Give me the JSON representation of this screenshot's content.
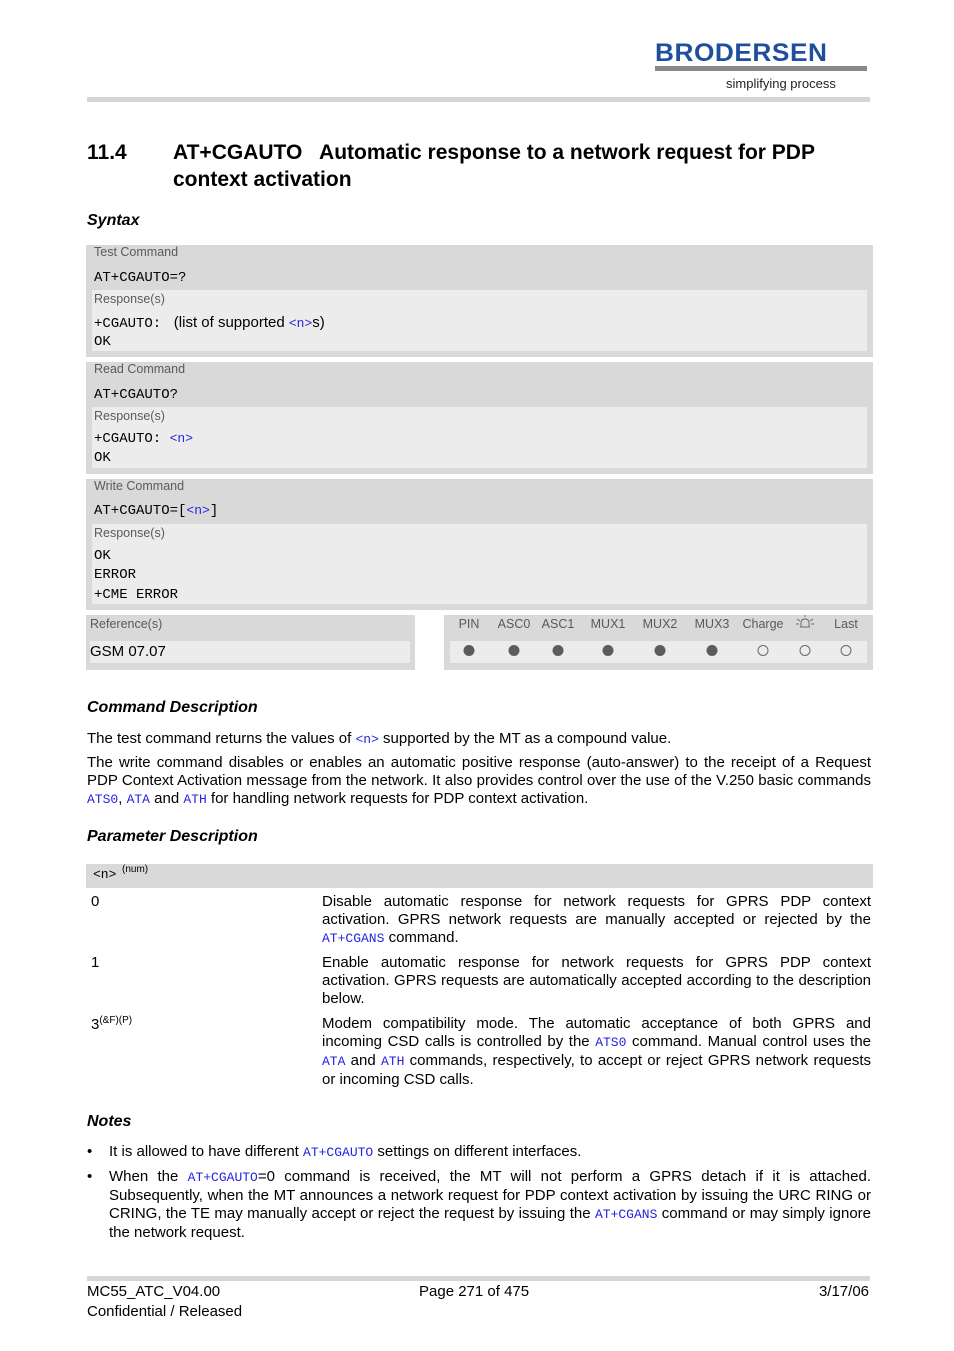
{
  "header": {
    "brand": "BRODERSEN",
    "tagline": "simplifying process",
    "brand_color": "#1e4f9c"
  },
  "section": {
    "number": "11.4",
    "title": "AT+CGAUTO   Automatic response to a network request for PDP context activation"
  },
  "syntax": {
    "heading": "Syntax",
    "test": {
      "label": "Test Command",
      "command": "AT+CGAUTO=?",
      "response_label": "Response(s)",
      "response_prefix": "+CGAUTO: ",
      "response_text_a": " (list of supported ",
      "response_param": "<n>",
      "response_text_b": "s)",
      "response_ok": "OK"
    },
    "read": {
      "label": "Read Command",
      "command": "AT+CGAUTO?",
      "response_label": "Response(s)",
      "response_prefix": "+CGAUTO: ",
      "response_param": "<n>",
      "response_ok": "OK"
    },
    "write": {
      "label": "Write Command",
      "command_prefix": "AT+CGAUTO=[",
      "command_param": "<n>",
      "command_suffix": "]",
      "response_label": "Response(s)",
      "responses": [
        "OK",
        "ERROR",
        "+CME ERROR"
      ]
    },
    "reference": {
      "label": "Reference(s)",
      "value": "GSM 07.07"
    },
    "interfaces": {
      "headers": [
        "PIN",
        "ASC0",
        "ASC1",
        "MUX1",
        "MUX2",
        "MUX3",
        "Charge",
        "alarm-icon",
        "Last"
      ],
      "values": [
        "filled",
        "filled",
        "filled",
        "filled",
        "filled",
        "filled",
        "empty",
        "empty",
        "empty"
      ]
    }
  },
  "command_description": {
    "heading": "Command Description",
    "p1_a": "The test command returns the values of ",
    "p1_param": "<n>",
    "p1_b": " supported by the MT as a compound value.",
    "p2_a": "The write command disables or enables an automatic positive response (auto-answer) to the receipt of a Request PDP Context Activation message from the network. It also provides control over the use of the V.250 basic commands ",
    "p2_link1": "ATS0",
    "p2_sep": ", ",
    "p2_link2": "ATA",
    "p2_and": " and ",
    "p2_link3": "ATH",
    "p2_b": " for handling network requests for PDP context activation."
  },
  "parameter_description": {
    "heading": "Parameter Description",
    "param_name": "<n>",
    "param_type": "(num)",
    "values": [
      {
        "value": "0",
        "sup": "",
        "desc_a": "Disable automatic response for network requests for GPRS PDP context activation. GPRS network requests are manually accepted or rejected by the ",
        "link": "AT+CGANS",
        "desc_b": " command."
      },
      {
        "value": "1",
        "sup": "",
        "desc_a": "Enable automatic response for network requests for GPRS PDP context activation. GPRS requests are automatically accepted according to the description below."
      },
      {
        "value": "3",
        "sup": "(&F)(P)",
        "desc_a": "Modem compatibility mode. The automatic acceptance of both GPRS and incoming CSD calls is controlled by the ",
        "link1": "ATS0",
        "desc_b": " command. Manual control uses the ",
        "link2": "ATA",
        "desc_c": " and ",
        "link3": "ATH",
        "desc_d": " commands, respectively, to accept or reject GPRS network requests or incoming CSD calls."
      }
    ]
  },
  "notes": {
    "heading": "Notes",
    "items": [
      {
        "a": "It is allowed to have different ",
        "link": "AT+CGAUTO",
        "b": " settings on different interfaces."
      },
      {
        "a": "When the ",
        "link1": "AT+CGAUTO",
        "b": "=0 command is received, the MT will not perform a GPRS detach if it is attached. Subsequently, when the MT announces a network request for PDP context activation by issuing the URC RING or CRING, the TE may manually accept or reject the request by issuing the ",
        "link2": "AT+CGANS",
        "c": " command or may simply ignore the network request."
      }
    ]
  },
  "footer": {
    "doc_id": "MC55_ATC_V04.00",
    "status": "Confidential / Released",
    "page": "Page 271 of 475",
    "date": "3/17/06"
  }
}
